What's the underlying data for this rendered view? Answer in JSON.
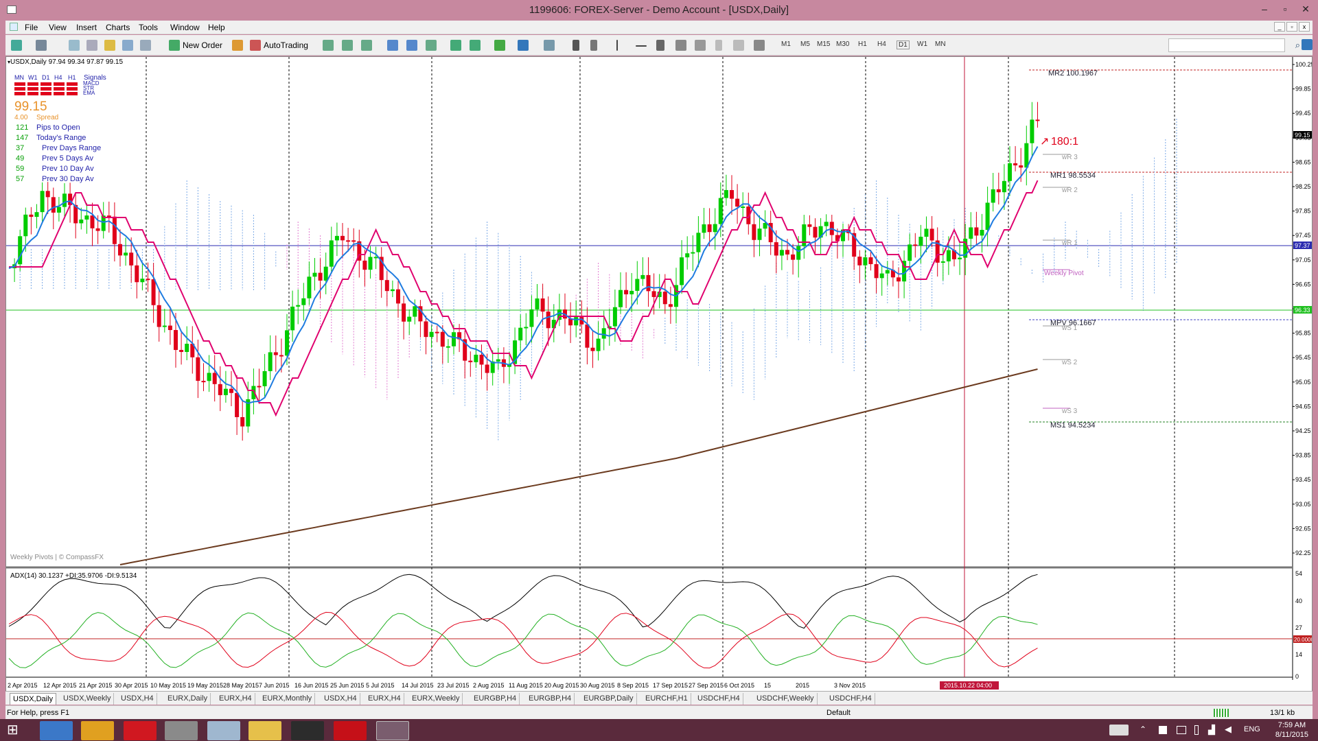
{
  "window": {
    "title": "1199606: FOREX-Server - Demo Account - [USDX,Daily]"
  },
  "menu": [
    "File",
    "View",
    "Insert",
    "Charts",
    "Tools",
    "Window",
    "Help"
  ],
  "toolbar": {
    "new_order": "New Order",
    "autotrading": "AutoTrading",
    "timeframes": [
      "M1",
      "M5",
      "M15",
      "M30",
      "H1",
      "H4",
      "D1",
      "W1",
      "MN"
    ]
  },
  "chart": {
    "header": "USDX,Daily  97.94 99.34 97.87 99.15",
    "signals": {
      "cols": [
        "MN",
        "W1",
        "D1",
        "H4",
        "H1",
        "Signals"
      ],
      "rows": [
        "MACD",
        "STR",
        "EMA"
      ]
    },
    "price": "99.15",
    "spread": "4.00",
    "spread_label": "Spread",
    "stats": [
      {
        "value": "121",
        "label": "Pips to Open"
      },
      {
        "value": "147",
        "label": "Today's Range"
      },
      {
        "value": "37",
        "label": "Prev Days Range"
      },
      {
        "value": "49",
        "label": "Prev 5 Days Av"
      },
      {
        "value": "59",
        "label": "Prev 10 Day Av"
      },
      {
        "value": "57",
        "label": "Prev 30 Day Av"
      }
    ],
    "pivots": {
      "mr2": "MR2  100.1967",
      "mr1": "MR1  98.5534",
      "mpv": "MPV  96.1667",
      "ms1": "MS1  94.5234",
      "wr3": "wR 3",
      "wr2": "wR 2",
      "wr1": "wR 1",
      "weekly": "Weekly Pivot",
      "ws1": "wS 1",
      "ws2": "wS 2",
      "ws3": "wS 3"
    },
    "ratio": "180:1",
    "watermark": "Weekly Pivots | © CompassFX",
    "price_axis": [
      "100.25",
      "99.85",
      "99.45",
      "99.05",
      "98.65",
      "98.25",
      "97.85",
      "97.45",
      "97.05",
      "96.65",
      "96.25",
      "95.85",
      "95.45",
      "95.05",
      "94.65",
      "94.25",
      "93.85",
      "93.45",
      "93.05",
      "92.65",
      "92.25"
    ],
    "price_tags": {
      "last": "99.15",
      "blue": "97.37",
      "green": "96.33"
    },
    "adx_header": "ADX(14) 30.1237 +DI:35.9706 -DI:9.5134",
    "adx_axis": [
      "54",
      "40",
      "27",
      "14",
      "0"
    ],
    "adx_tag": "20.0000",
    "date_axis": [
      "2 Apr 2015",
      "12 Apr 2015",
      "21 Apr 2015",
      "30 Apr 2015",
      "10 May 2015",
      "19 May 2015",
      "28 May 2015",
      "7 Jun 2015",
      "16 Jun 2015",
      "25 Jun 2015",
      "5 Jul 2015",
      "14 Jul 2015",
      "23 Jul 2015",
      "2 Aug 2015",
      "11 Aug 2015",
      "20 Aug 2015",
      "30 Aug 2015",
      "8 Sep 2015",
      "17 Sep 2015",
      "27 Sep 2015",
      "6 Oct 2015",
      "15",
      "2015",
      "3 Nov 2015"
    ],
    "date_highlight": "2015.10.22 04:00"
  },
  "tabs": [
    "USDX,Daily",
    "USDX,Weekly",
    "USDX,H4",
    "EURX,Daily",
    "EURX,H4",
    "EURX,Monthly",
    "USDX,H4",
    "EURX,H4",
    "EURX,Weekly",
    "EURGBP,H4",
    "EURGBP,H4",
    "EURGBP,Daily",
    "EURCHF,H1",
    "USDCHF,H4",
    "USDCHF,Weekly",
    "USDCHF,H4"
  ],
  "status": {
    "help": "For Help, press F1",
    "profile": "Default",
    "traffic": "13/1 kb"
  },
  "taskbar": {
    "lang": "ENG",
    "time": "7:59 AM",
    "date": "8/11/2015"
  },
  "colors": {
    "bull": "#00cc00",
    "bear": "#e0001a",
    "kijun": "#e0006e",
    "tenkan": "#1e7be0",
    "ma": "#6b3a1e",
    "window": "#c7889f"
  }
}
